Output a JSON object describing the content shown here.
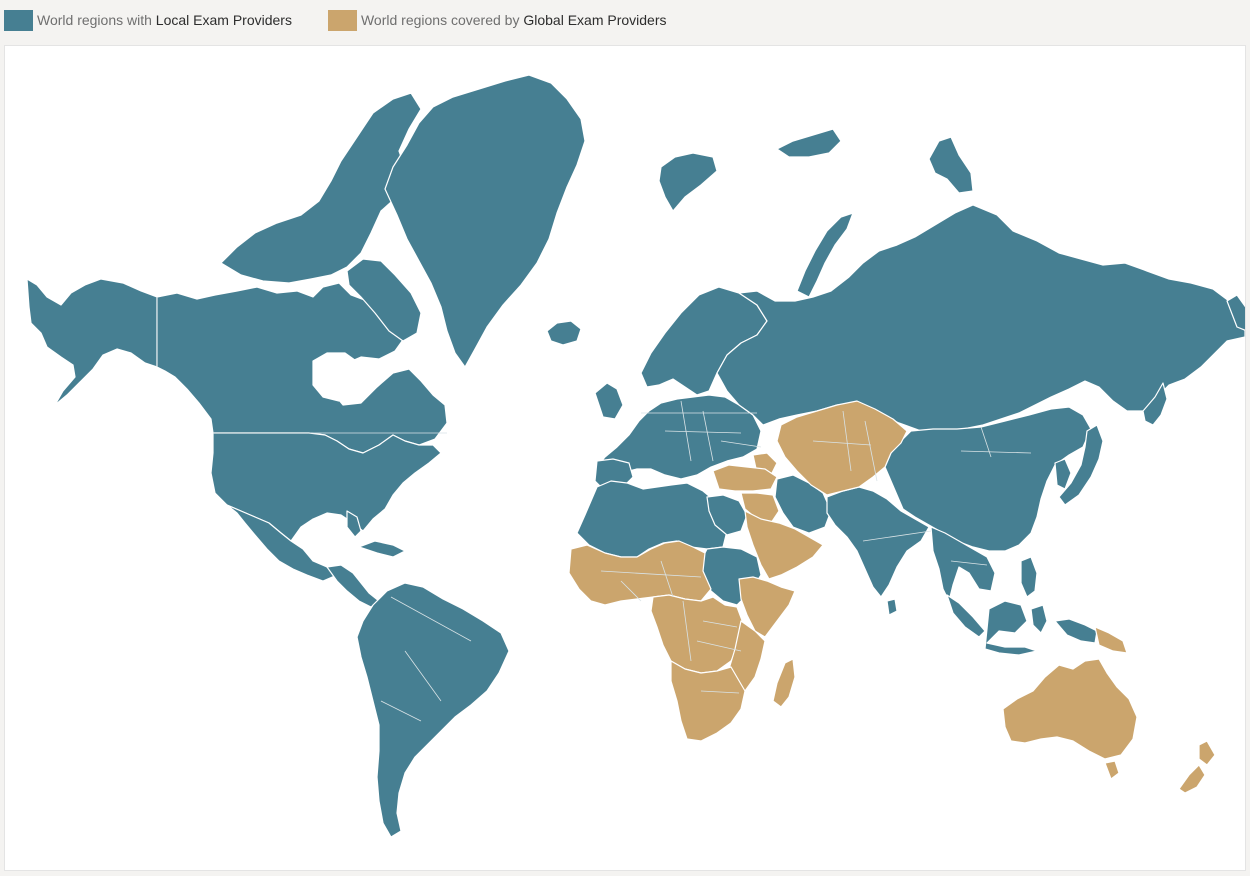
{
  "legend": {
    "local": {
      "prefix": "World regions with ",
      "emphasis": "Local Exam Providers",
      "color": "#467f92"
    },
    "global": {
      "prefix": "World regions covered by ",
      "emphasis": "Global Exam Providers",
      "color": "#cba56d"
    }
  },
  "map": {
    "local_color": "#467f92",
    "global_color": "#cba56d",
    "land_border_color": "#ffffff",
    "local_regions": [
      "Alaska",
      "Canada",
      "Arctic Islands",
      "Greenland",
      "Iceland",
      "United States",
      "Mexico",
      "Central America",
      "Caribbean",
      "South America",
      "Europe",
      "Scandinavia",
      "Svalbard",
      "Russia",
      "Novaya Zemlya",
      "Northern Africa",
      "Sudan",
      "Iran",
      "South Asia",
      "China",
      "Mongolia",
      "Japan",
      "Korea",
      "Southeast Asia",
      "Indonesia",
      "Philippines",
      "Papua New Guinea"
    ],
    "global_regions": [
      "Central Asia",
      "Turkey",
      "Middle East",
      "Arabian Peninsula",
      "West Africa",
      "Central Africa",
      "East Africa",
      "Southern Africa",
      "Madagascar",
      "Australia",
      "Tasmania",
      "New Zealand"
    ]
  }
}
